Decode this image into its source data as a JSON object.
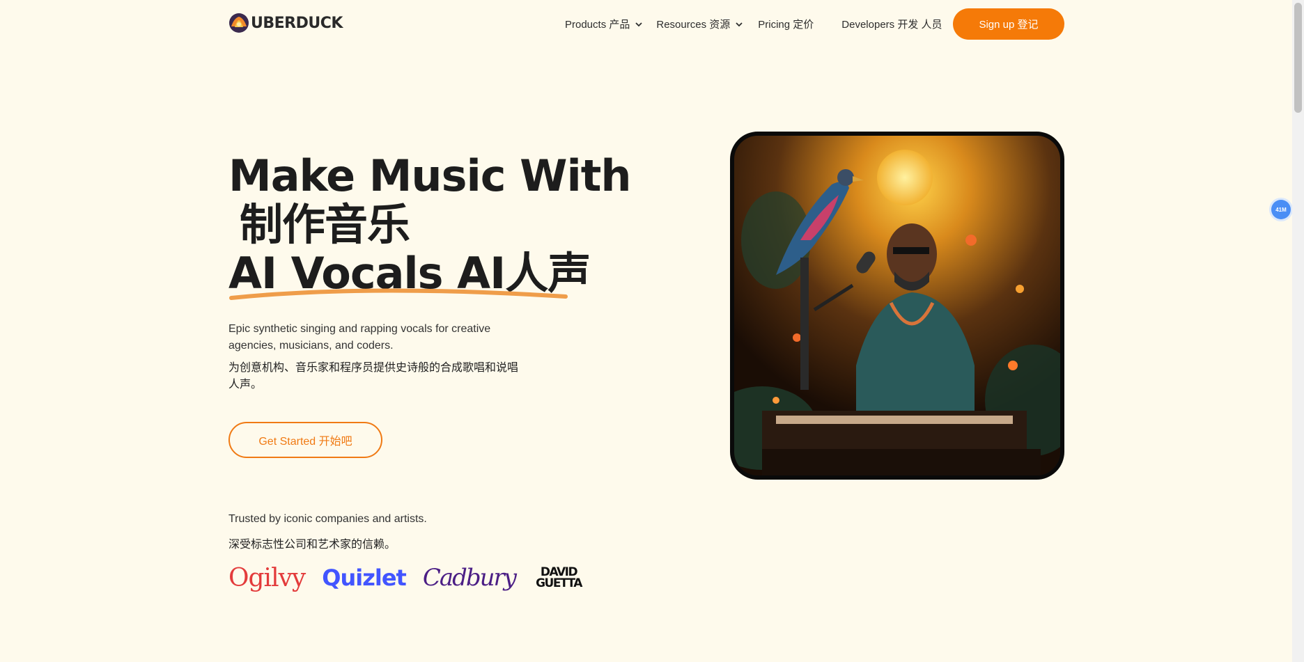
{
  "nav": {
    "logo_text": "UBERDUCK",
    "products_label": "Products 产品",
    "resources_label": "Resources 资源",
    "pricing_label": "Pricing 定价",
    "developers_label": "Developers 开发 人员",
    "signup_label": "Sign up 登记"
  },
  "hero": {
    "title_line1": "Make Music With",
    "title_line2": "制作音乐",
    "title_line3": "AI Vocals AI人声",
    "description": "Epic synthetic singing and rapping vocals for creative agencies, musicians, and coders.",
    "description_zh": "为创意机构、音乐家和程序员提供史诗般的合成歌唱和说唱人声。",
    "cta_label": "Get Started 开始吧"
  },
  "trusted": {
    "label": "Trusted by iconic companies and artists.",
    "label_zh": "深受标志性公司和艺术家的信赖。",
    "brands": [
      "Ogilvy",
      "Quizlet",
      "Cadbury",
      "DAVID GUETTA"
    ]
  },
  "badge": {
    "text": "41M"
  },
  "colors": {
    "accent": "#f57a08",
    "background": "#fefaec"
  }
}
